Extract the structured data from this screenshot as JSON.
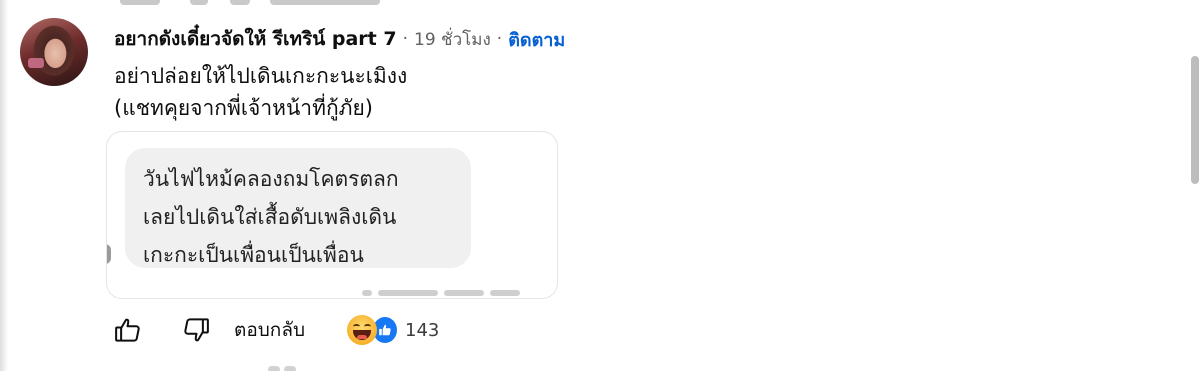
{
  "comment": {
    "author": "อยากดังเดี๋ยวจัดให้ รีเทริน์ part 7",
    "separator": "·",
    "time": "19 ชั่วโมง",
    "follow_label": "ติดตาม",
    "lines": [
      "อย่าปล่อยให้ไปเดินเกะกะนะเมิงง",
      "(แชทคุยจากพี่เจ้าหน้าที่กู้ภัย)"
    ]
  },
  "attachment": {
    "bubble_lines": [
      "วันไฟไหม้คลองถมโคตรตลก",
      "เลยไปเดินใส่เสื้อดับเพลิงเดิน",
      "เกะกะเป็นเพื่อนเป็นเพื่อน"
    ]
  },
  "actions": {
    "like_icon": "thumbs-up-icon",
    "dislike_icon": "thumbs-down-icon",
    "reply_label": "ตอบกลับ",
    "reactions": [
      "haha-reaction-icon",
      "like-reaction-icon"
    ],
    "reaction_count": "143"
  },
  "colors": {
    "follow": "#065fd4",
    "like_badge": "#1877f2",
    "bubble": "#f0f0f0"
  }
}
